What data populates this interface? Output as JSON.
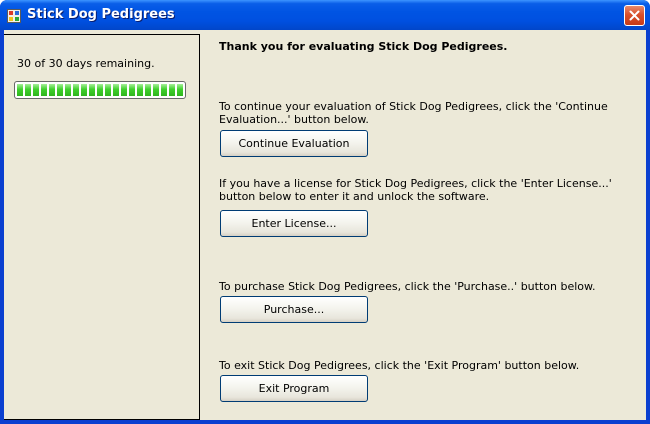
{
  "window": {
    "title": "Stick Dog Pedigrees"
  },
  "left_panel": {
    "days_remaining_text": "30 of 30 days remaining.",
    "progress_fraction": 1.0
  },
  "main": {
    "heading": "Thank you for evaluating Stick Dog Pedigrees.",
    "sections": [
      {
        "text": "To continue your evaluation of Stick Dog Pedigrees, click the 'Continue Evaluation...' button below.",
        "button_label": "Continue Evaluation"
      },
      {
        "text": "If you have a license for Stick Dog Pedigrees, click the 'Enter License...' button below to enter it and unlock the software.",
        "button_label": "Enter License..."
      },
      {
        "text": "To purchase Stick Dog Pedigrees, click the 'Purchase..' button below.",
        "button_label": "Purchase..."
      },
      {
        "text": "To exit Stick Dog Pedigrees, click the 'Exit Program' button below.",
        "button_label": "Exit Program"
      }
    ]
  },
  "colors": {
    "titlebar": "#0054e3",
    "client_background": "#ece9d8",
    "progress_green": "#3fcf2c",
    "close_button": "#d9502c"
  },
  "icons": {
    "app": "app-icon",
    "close": "close-icon"
  }
}
